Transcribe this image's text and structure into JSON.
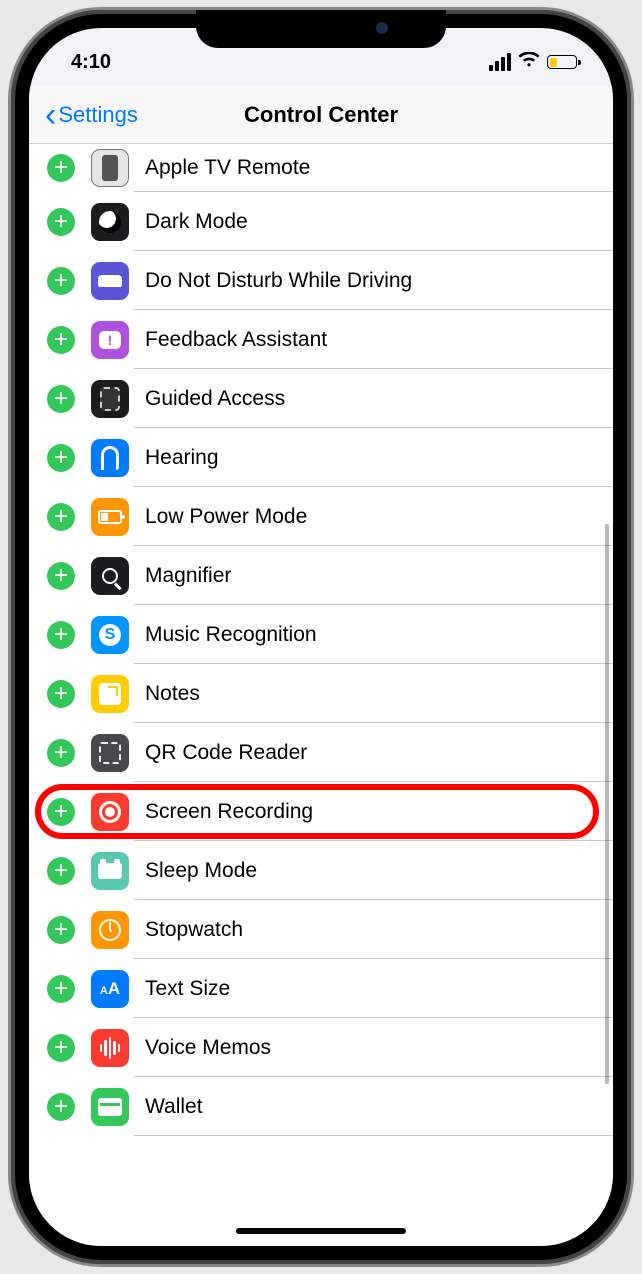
{
  "status": {
    "time": "4:10"
  },
  "nav": {
    "back_label": "Settings",
    "title": "Control Center"
  },
  "items": [
    {
      "label": "Apple TV Remote",
      "icon": "apple-tv-remote-icon",
      "cls": "ic-chip"
    },
    {
      "label": "Dark Mode",
      "icon": "dark-mode-icon",
      "cls": "ic-dark"
    },
    {
      "label": "Do Not Disturb While Driving",
      "icon": "dnd-driving-icon",
      "cls": "ic-car"
    },
    {
      "label": "Feedback Assistant",
      "icon": "feedback-icon",
      "cls": "ic-feedback",
      "inner_text": "!"
    },
    {
      "label": "Guided Access",
      "icon": "guided-access-icon",
      "cls": "ic-guided"
    },
    {
      "label": "Hearing",
      "icon": "hearing-icon",
      "cls": "ic-hearing"
    },
    {
      "label": "Low Power Mode",
      "icon": "low-power-icon",
      "cls": "ic-lowpower"
    },
    {
      "label": "Magnifier",
      "icon": "magnifier-icon",
      "cls": "ic-mag"
    },
    {
      "label": "Music Recognition",
      "icon": "shazam-icon",
      "cls": "ic-shazam",
      "inner_text": "S"
    },
    {
      "label": "Notes",
      "icon": "notes-icon",
      "cls": "ic-notes"
    },
    {
      "label": "QR Code Reader",
      "icon": "qr-reader-icon",
      "cls": "ic-qr"
    },
    {
      "label": "Screen Recording",
      "icon": "screen-record-icon",
      "cls": "ic-record",
      "highlight": true
    },
    {
      "label": "Sleep Mode",
      "icon": "sleep-mode-icon",
      "cls": "ic-sleep"
    },
    {
      "label": "Stopwatch",
      "icon": "stopwatch-icon",
      "cls": "ic-stop"
    },
    {
      "label": "Text Size",
      "icon": "text-size-icon",
      "cls": "ic-text",
      "inner_html": "<span style='font-size:11px'>A</span><span style='font-size:17px'>A</span>"
    },
    {
      "label": "Voice Memos",
      "icon": "voice-memos-icon",
      "cls": "ic-voice",
      "inner_html": "<span></span><span></span><span></span><span></span><span></span>"
    },
    {
      "label": "Wallet",
      "icon": "wallet-icon",
      "cls": "ic-wallet"
    }
  ]
}
